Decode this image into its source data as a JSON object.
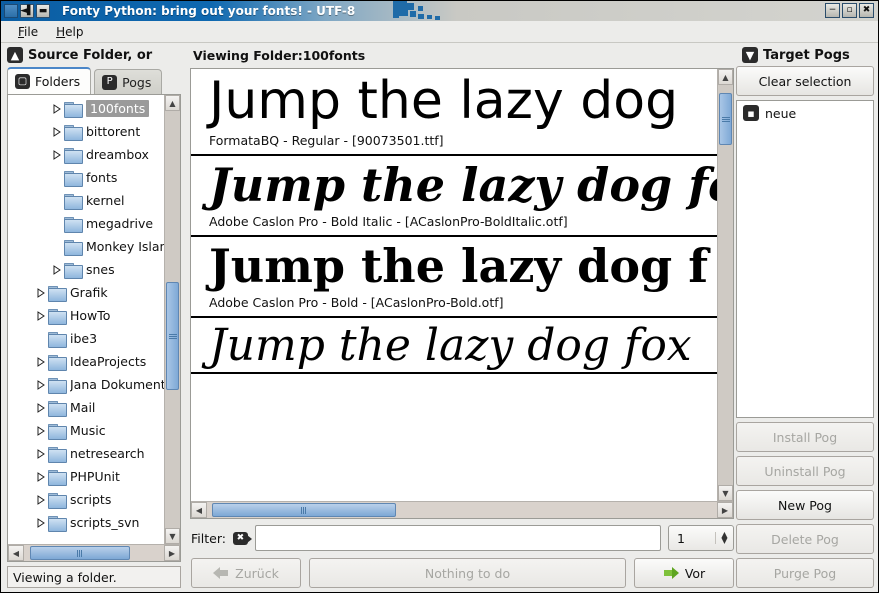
{
  "window": {
    "title": "Fonty Python: bring out your fonts!  -  UTF-8",
    "controls": {
      "left_blank": "",
      "shade": "◄▌",
      "iconify": "▬",
      "minimize": "−",
      "maximize": "▫",
      "close": "✖"
    }
  },
  "menubar": {
    "items": [
      {
        "label": "File",
        "accel": "F"
      },
      {
        "label": "Help",
        "accel": "H"
      }
    ]
  },
  "left_pane": {
    "header": {
      "icon": "up-arrow-icon",
      "glyph": "▲",
      "label": "Source Folder, or"
    },
    "tabs": [
      {
        "label": "Folders",
        "icon": "folder-icon",
        "glyph": "▢",
        "active": true
      },
      {
        "label": "Pogs",
        "icon": "pog-icon",
        "glyph": "P",
        "active": false
      }
    ],
    "tree": [
      {
        "label": "100fonts",
        "depth": 2,
        "expandable": true,
        "selected": true
      },
      {
        "label": "bittorent",
        "depth": 2,
        "expandable": true,
        "selected": false
      },
      {
        "label": "dreambox",
        "depth": 2,
        "expandable": true,
        "selected": false
      },
      {
        "label": "fonts",
        "depth": 2,
        "expandable": false,
        "selected": false
      },
      {
        "label": "kernel",
        "depth": 2,
        "expandable": false,
        "selected": false
      },
      {
        "label": "megadrive",
        "depth": 2,
        "expandable": false,
        "selected": false
      },
      {
        "label": "Monkey Island",
        "depth": 2,
        "expandable": false,
        "selected": false
      },
      {
        "label": "snes",
        "depth": 2,
        "expandable": true,
        "selected": false
      },
      {
        "label": "Grafik",
        "depth": 1,
        "expandable": true,
        "selected": false
      },
      {
        "label": "HowTo",
        "depth": 1,
        "expandable": true,
        "selected": false
      },
      {
        "label": "ibe3",
        "depth": 1,
        "expandable": false,
        "selected": false
      },
      {
        "label": "IdeaProjects",
        "depth": 1,
        "expandable": true,
        "selected": false
      },
      {
        "label": "Jana Dokumente",
        "depth": 1,
        "expandable": true,
        "selected": false
      },
      {
        "label": "Mail",
        "depth": 1,
        "expandable": true,
        "selected": false
      },
      {
        "label": "Music",
        "depth": 1,
        "expandable": true,
        "selected": false
      },
      {
        "label": "netresearch",
        "depth": 1,
        "expandable": true,
        "selected": false
      },
      {
        "label": "PHPUnit",
        "depth": 1,
        "expandable": true,
        "selected": false
      },
      {
        "label": "scripts",
        "depth": 1,
        "expandable": true,
        "selected": false
      },
      {
        "label": "scripts_svn",
        "depth": 1,
        "expandable": true,
        "selected": false
      }
    ],
    "scroll": {
      "v_thumb_top_pct": 41,
      "v_thumb_height_pct": 26,
      "h_thumb_left_pct": 4,
      "h_thumb_width_pct": 72
    }
  },
  "center_pane": {
    "viewing_label": "Viewing Folder:100fonts",
    "fonts": [
      {
        "sample": "Jump the lazy dog",
        "name": "FormataBQ - Regular - [90073501.ttf]",
        "style": "s-sans"
      },
      {
        "sample": "Jump the lazy dog fo",
        "name": "Adobe Caslon Pro - Bold Italic - [ACaslonPro-BoldItalic.otf]",
        "style": "s-serif-bi"
      },
      {
        "sample": "Jump the lazy dog f",
        "name": "Adobe Caslon Pro - Bold - [ACaslonPro-Bold.otf]",
        "style": "s-serif-b"
      },
      {
        "sample": "Jump the lazy dog fox",
        "name": "",
        "style": "s-serif-i"
      }
    ],
    "scroll": {
      "v_thumb_top_pct": 2,
      "v_thumb_height_pct": 13,
      "h_thumb_left_pct": 1,
      "h_thumb_width_pct": 36
    },
    "filter": {
      "label": "Filter:",
      "value": "",
      "placeholder": "",
      "clear_icon": "clear-filter-icon",
      "clear_glyph": "✖"
    },
    "spinner": {
      "value": "1",
      "up_glyph": "▲",
      "down_glyph": "▼"
    },
    "nav": {
      "back": {
        "label": "Zurück",
        "accel": "Z",
        "enabled": false
      },
      "middle": {
        "label": "Nothing to do",
        "enabled": false
      },
      "forward": {
        "label": "Vor",
        "accel": "V",
        "enabled": true
      }
    }
  },
  "right_pane": {
    "header": {
      "icon": "down-arrow-icon",
      "glyph": "▼",
      "label": "Target Pogs"
    },
    "clear_selection_label": "Clear selection",
    "pogs": [
      {
        "label": "neue",
        "icon": "pog-icon",
        "glyph": "▪"
      }
    ],
    "buttons": [
      {
        "label": "Install Pog",
        "enabled": false
      },
      {
        "label": "Uninstall Pog",
        "enabled": false
      },
      {
        "label": "New Pog",
        "enabled": true
      },
      {
        "label": "Delete Pog",
        "enabled": false
      },
      {
        "label": "Purge Pog",
        "enabled": false
      }
    ]
  },
  "statusbar": {
    "text": "Viewing a folder."
  },
  "colors": {
    "title_blue": "#0c5ea3",
    "title_gray": "#d4d4cf",
    "selection_gray": "#9a9a9a",
    "scroll_blue": "#7fa9d6",
    "tab_accent": "#4a86c8",
    "forward_green": "#7ec13a",
    "panel_bg": "#ececea"
  }
}
